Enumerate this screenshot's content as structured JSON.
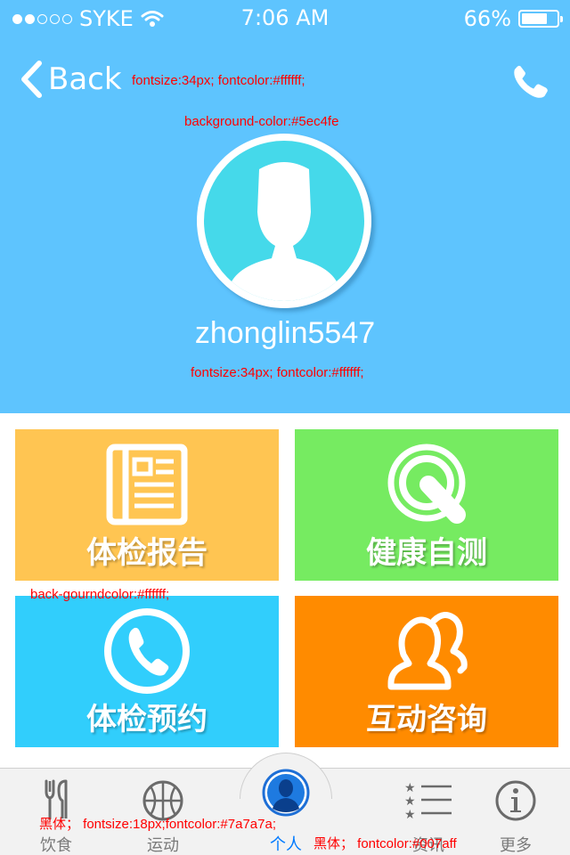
{
  "status_bar": {
    "carrier": "SYKE",
    "time": "7:06 AM",
    "battery_text": "66%",
    "battery_level": 0.66,
    "signal_bars_filled": 2,
    "signal_bars_total": 5
  },
  "nav": {
    "back_label": "Back",
    "call_icon": "phone-icon"
  },
  "profile": {
    "username": "zhonglin5547",
    "avatar_icon": "user-silhouette-icon"
  },
  "tiles": [
    {
      "label": "体检报告",
      "icon": "newspaper-icon",
      "color": "#ffc552"
    },
    {
      "label": "健康自测",
      "icon": "magnifier-icon",
      "color": "#76eb61"
    },
    {
      "label": "体检预约",
      "icon": "phone-circle-icon",
      "color": "#31cefc"
    },
    {
      "label": "互动咨询",
      "icon": "chat-people-icon",
      "color": "#ff8b00"
    }
  ],
  "tabbar": {
    "items": [
      {
        "label": "饮食",
        "icon": "fork-knife-icon"
      },
      {
        "label": "运动",
        "icon": "basketball-icon"
      },
      {
        "label": "个人",
        "icon": "person-icon"
      },
      {
        "label": "资讯",
        "icon": "star-list-icon"
      },
      {
        "label": "更多",
        "icon": "info-icon"
      }
    ],
    "active_index": 2
  },
  "annotations": {
    "back_note": "fontsize:34px; fontcolor:#ffffff;",
    "bg_note": "background-color:#5ec4fe",
    "username_note": "fontsize:34px; fontcolor:#ffffff;",
    "tile_bg_note": "back-gourndcolor:#ffffff;",
    "tab_inactive_note": "黑体；  fontsize:18px;fontcolor:#7a7a7a;",
    "tab_active_note": "黑体；  fontcolor:#007aff"
  },
  "colors": {
    "header_bg": "#5ec4fe",
    "page_bg": "#ffffff",
    "tab_inactive": "#7a7a7a",
    "tab_active": "#007aff"
  }
}
